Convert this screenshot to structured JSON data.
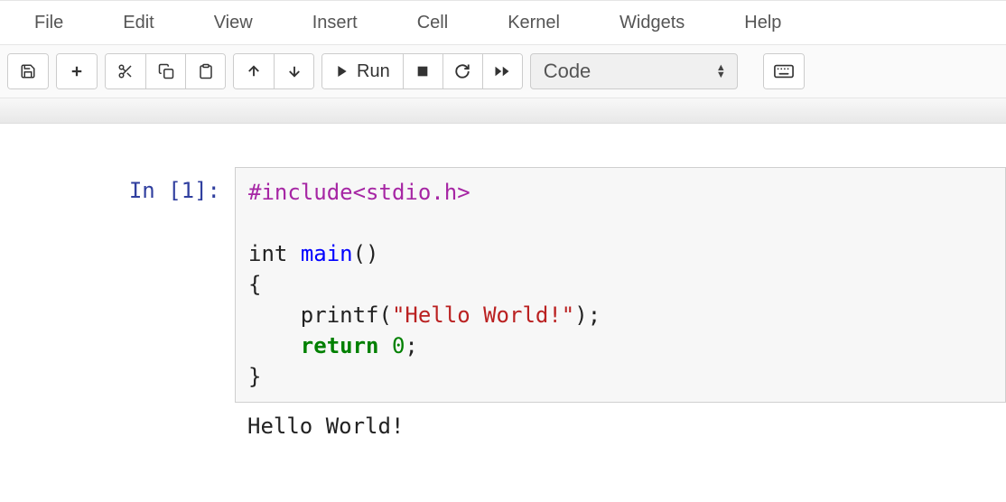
{
  "menu": {
    "items": [
      "File",
      "Edit",
      "View",
      "Insert",
      "Cell",
      "Kernel",
      "Widgets",
      "Help"
    ]
  },
  "toolbar": {
    "run_label": "Run",
    "cell_type": "Code"
  },
  "cell": {
    "prompt_prefix": "In [",
    "prompt_num": "1",
    "prompt_suffix": "]:",
    "code": {
      "include": "#include<stdio.h>",
      "type_kw": "int",
      "func_name": "main",
      "func_parens": "()",
      "brace_open": "{",
      "printf_call": "    printf(",
      "string_lit": "\"Hello World!\"",
      "printf_end": ");",
      "return_kw": "return",
      "return_val": "0",
      "return_end": ";",
      "indent": "    ",
      "brace_close": "}"
    },
    "output": "Hello World!"
  }
}
